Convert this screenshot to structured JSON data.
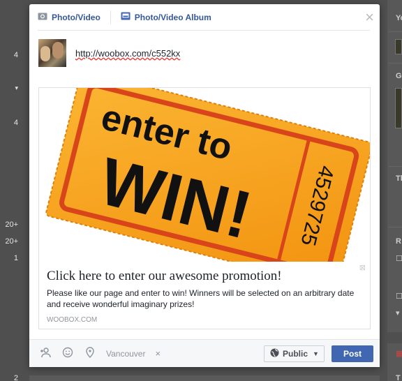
{
  "background": {
    "left_numbers": [
      "4",
      "4",
      "20+",
      "20+",
      "1",
      "2"
    ],
    "right_letters": [
      "Yo",
      "G",
      "Th",
      "R"
    ]
  },
  "dialog": {
    "tabs": [
      {
        "label": "Photo/Video",
        "icon": "camera-icon"
      },
      {
        "label": "Photo/Video Album",
        "icon": "album-icon"
      }
    ],
    "close_label": "×",
    "composer": {
      "url": "http://woobox.com/c552kx"
    },
    "card": {
      "image": {
        "line1": "enter to",
        "line2": "WIN!",
        "ticket_number": "4529725",
        "ticket_color": "#f7a21b"
      },
      "title": "Click here to enter our awesome promotion!",
      "description": "Please like our page and enter to win! Winners will be selected on an arbitrary date and receive wonderful imaginary prizes!",
      "domain": "WOOBOX.COM"
    },
    "footer": {
      "location": "Vancouver",
      "location_remove": "×",
      "privacy_label": "Public",
      "post_label": "Post"
    }
  },
  "colors": {
    "accent": "#4267b2",
    "link": "#365899"
  }
}
